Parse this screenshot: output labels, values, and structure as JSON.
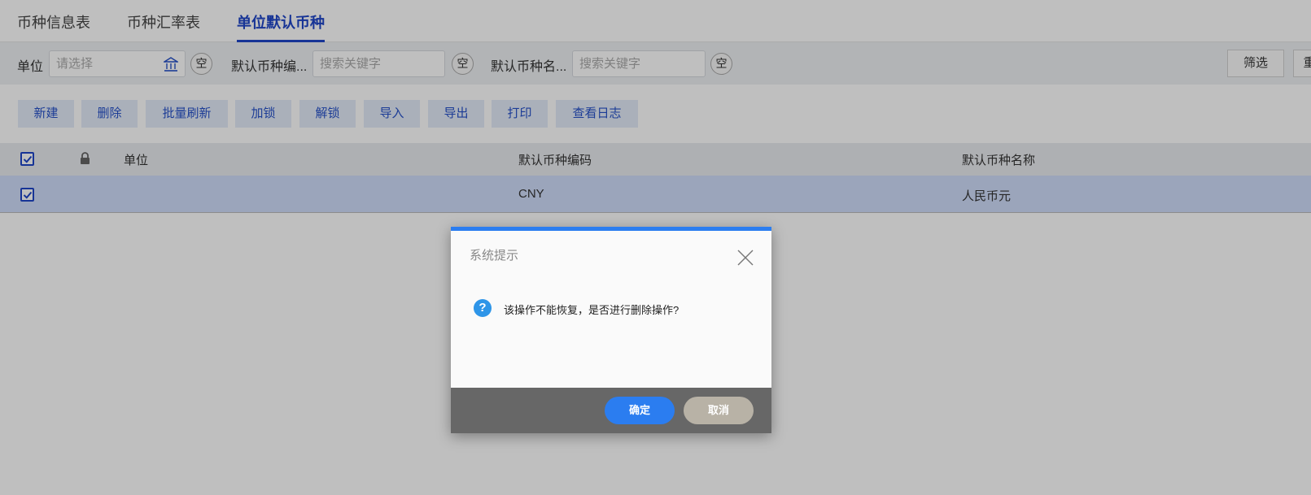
{
  "tabs": [
    {
      "label": "币种信息表"
    },
    {
      "label": "币种汇率表"
    },
    {
      "label": "单位默认币种"
    }
  ],
  "filters": {
    "unit_label": "单位",
    "unit_placeholder": "请选择",
    "code_label": "默认币种编...",
    "code_placeholder": "搜索关键字",
    "name_label": "默认币种名...",
    "name_placeholder": "搜索关键字",
    "clear_label": "空",
    "filter_button": "筛选",
    "reset_button": "重"
  },
  "toolbar": [
    {
      "label": "新建"
    },
    {
      "label": "删除"
    },
    {
      "label": "批量刷新"
    },
    {
      "label": "加锁"
    },
    {
      "label": "解锁"
    },
    {
      "label": "导入"
    },
    {
      "label": "导出"
    },
    {
      "label": "打印"
    },
    {
      "label": "查看日志"
    }
  ],
  "table": {
    "headers": {
      "unit": "单位",
      "code": "默认币种编码",
      "name": "默认币种名称"
    },
    "rows": [
      {
        "unit": "",
        "code": "CNY",
        "name": "人民币元"
      }
    ]
  },
  "dialog": {
    "title": "系统提示",
    "message": "该操作不能恢复，是否进行删除操作?",
    "ok": "确定",
    "cancel": "取消"
  },
  "colors": {
    "accent": "#1f46c8",
    "dialog_top": "#2b7df0",
    "ok_button": "#2b7df0",
    "cancel_button": "#b8b2a6",
    "selected_row": "#cfdcfa"
  }
}
